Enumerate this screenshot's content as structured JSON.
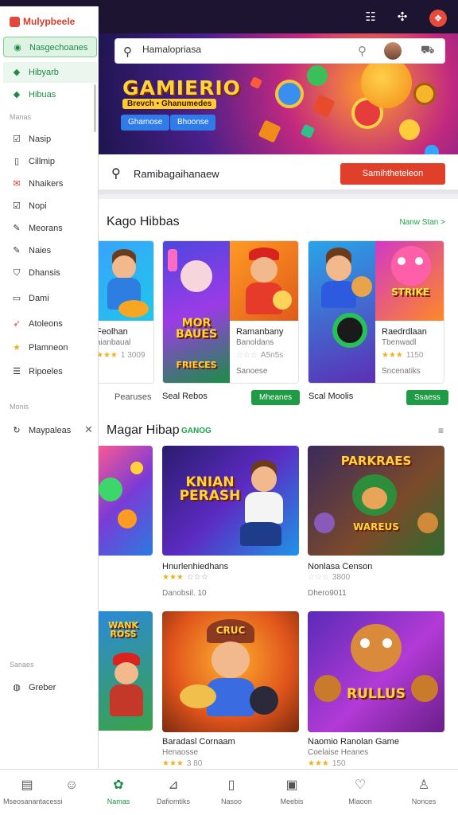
{
  "topbar": {
    "icons": [
      "grid-icon",
      "gamepad-icon",
      "profile-badge-icon"
    ]
  },
  "hero": {
    "search_placeholder": "Hamalopriasa",
    "brand": "GAMIERIO",
    "tagline": "Brevch • Ghanumedes",
    "buttons": [
      "Ghamose",
      "Bhoonse"
    ]
  },
  "searchrow": {
    "text": "Ramibagaihanaew",
    "button": "Samihtheteleon"
  },
  "section1": {
    "title": "Kago Hibbas",
    "link": "Nanw Stan >",
    "cards": [
      {
        "title": "Feolhan",
        "sub": "aianbaual",
        "stars": "★★★",
        "meta": "1 3009"
      },
      {
        "title": "Ramanbany",
        "sub": "Banoldans",
        "stars": "☆☆☆",
        "meta": "A5n5s",
        "thumb_text1": "MOR BAUES",
        "thumb_text2": "FRIECES"
      },
      {
        "title": "Raedrdlaan",
        "sub": "Tbenwadl",
        "stars": "★★★",
        "meta": "1150",
        "thumb_text": "STRIKE"
      }
    ],
    "below": [
      {
        "price": "Pearuses"
      },
      {
        "price": "Sanoese",
        "title": "Seal Rebos",
        "button": "Mheanes"
      },
      {
        "price": "Sncenatiks",
        "title": "Scal Moolis",
        "button": "Ssaess"
      }
    ]
  },
  "section2": {
    "title": "Magar Hibap",
    "tag": "GANOG",
    "cards": [
      {
        "title": "Hnurlenhiedhans",
        "stars": "★★★",
        "meta": "☆☆☆",
        "sub": "Danobsil. 10",
        "thumb_text": "KNIAN PERASH"
      },
      {
        "title": "Nonlasa Censon",
        "stars": "☆☆☆",
        "meta": "3800",
        "sub": "Dhero9011",
        "thumb_text1": "PARKRAES",
        "thumb_text2": "WAREUS"
      }
    ]
  },
  "section3": {
    "cards": [
      {
        "title": "Baradasl Cornaam",
        "sub": "Henaosse",
        "stars": "★★★",
        "meta": "3 80",
        "thumb_text": "CRUC"
      },
      {
        "title": "Naomio Ranolan Game",
        "sub": "Coelaise Heanes",
        "stars": "★★★",
        "meta": "150",
        "thumb_text": "RULLUS"
      }
    ],
    "left_thumb_text": "WANK ROSS"
  },
  "sidebar": {
    "logo": "Mulypbeele",
    "primary": [
      {
        "label": "Nasgechoanes",
        "icon": "chat-icon"
      },
      {
        "label": "Hibyarb",
        "icon": "tag-icon"
      },
      {
        "label": "Hibuas",
        "icon": "tag-icon"
      }
    ],
    "head1": "Manas",
    "items": [
      {
        "label": "Nasip",
        "icon": "check-square-icon"
      },
      {
        "label": "Cillmip",
        "icon": "doc-icon"
      },
      {
        "label": "Nhaikers",
        "icon": "mail-icon"
      },
      {
        "label": "Nopi",
        "icon": "check-square-icon"
      },
      {
        "label": "Meorans",
        "icon": "pencil-square-icon"
      },
      {
        "label": "Naies",
        "icon": "pencil-square-icon"
      },
      {
        "label": "Dhansis",
        "icon": "shield-square-icon"
      },
      {
        "label": "Dami",
        "icon": "card-icon"
      },
      {
        "label": "Atoleons",
        "icon": "rocket-icon"
      },
      {
        "label": "Plamneon",
        "icon": "star-icon"
      },
      {
        "label": "Ripoeles",
        "icon": "list-icon"
      }
    ],
    "head2": "Monis",
    "sub_item": {
      "label": "Maypaleas",
      "icon": "loop-icon"
    },
    "head3": "Sanaes",
    "foot_item": {
      "label": "Greber",
      "icon": "globe-icon"
    }
  },
  "bottomnav": [
    {
      "label": "Mseosanantacessi",
      "icon": "home-icon"
    },
    {
      "label": "",
      "icon": "chat-face-icon"
    },
    {
      "label": "Namas",
      "icon": "leaf-icon",
      "active": true
    },
    {
      "label": "Dafiomtiks",
      "icon": "chart-icon"
    },
    {
      "label": "Nasoo",
      "icon": "device-icon"
    },
    {
      "label": "Meebis",
      "icon": "box-icon"
    },
    {
      "label": "Mlaoon",
      "icon": "heart-icon"
    },
    {
      "label": "Nonces",
      "icon": "user-icon"
    }
  ],
  "colors": {
    "accent_green": "#1d8c42",
    "accent_red": "#e0402a",
    "hero_dark": "#1d1550"
  }
}
